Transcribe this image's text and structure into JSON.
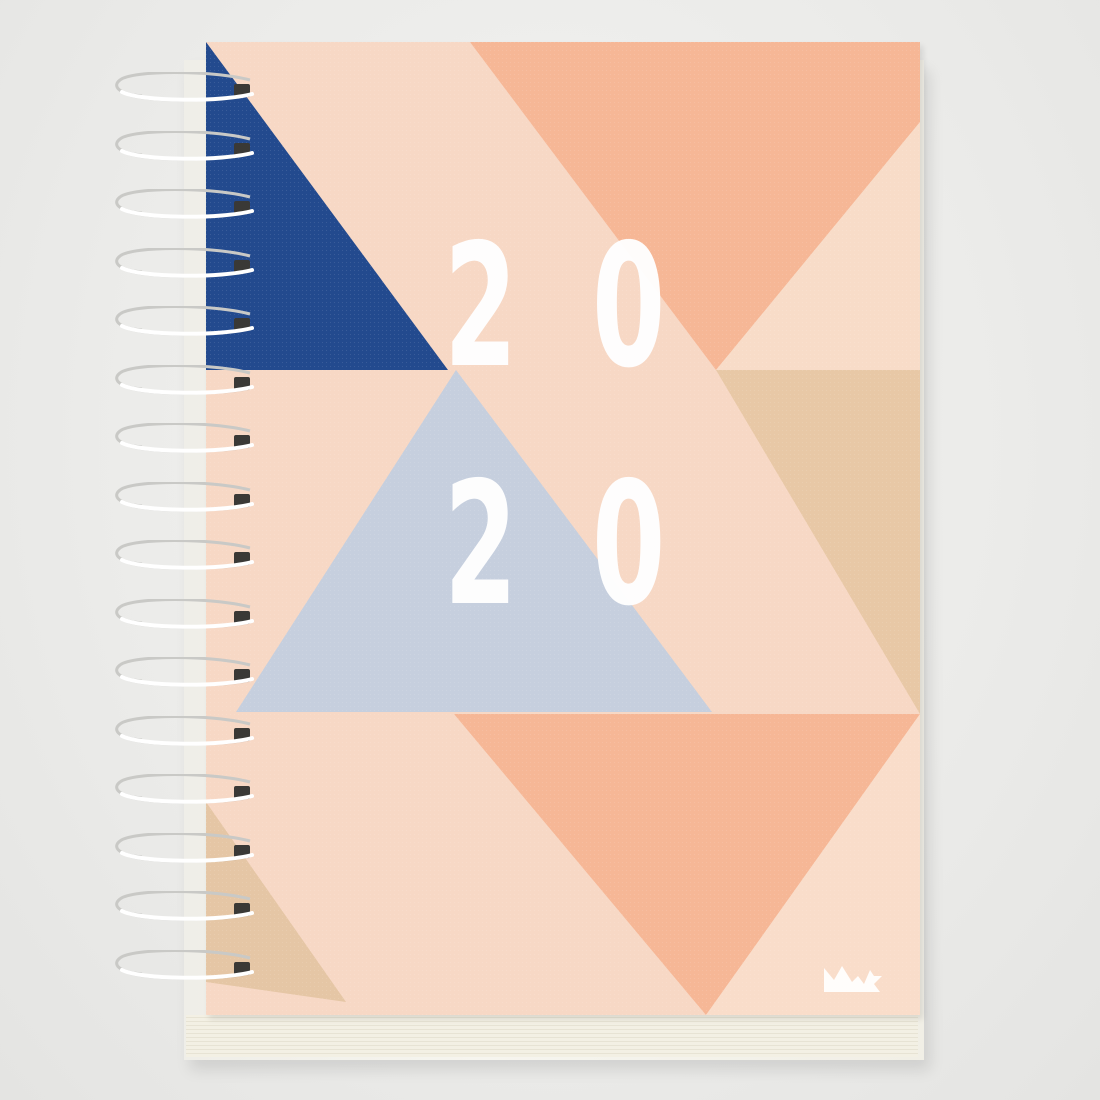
{
  "planner": {
    "year_row_1": [
      "2",
      "0"
    ],
    "year_row_2": [
      "2",
      "0"
    ]
  },
  "colors": {
    "background": "#ebebe9",
    "cover_base": "#f7d8c5",
    "peach": "#f6b796",
    "navy": "#234a8e",
    "light_blue": "#c6cfde",
    "sand": "#e8c8a6",
    "wire": "#ffffff"
  },
  "icons": {
    "logo": "mountain-bird-logo-icon"
  },
  "binding": {
    "coil_count": 16
  }
}
